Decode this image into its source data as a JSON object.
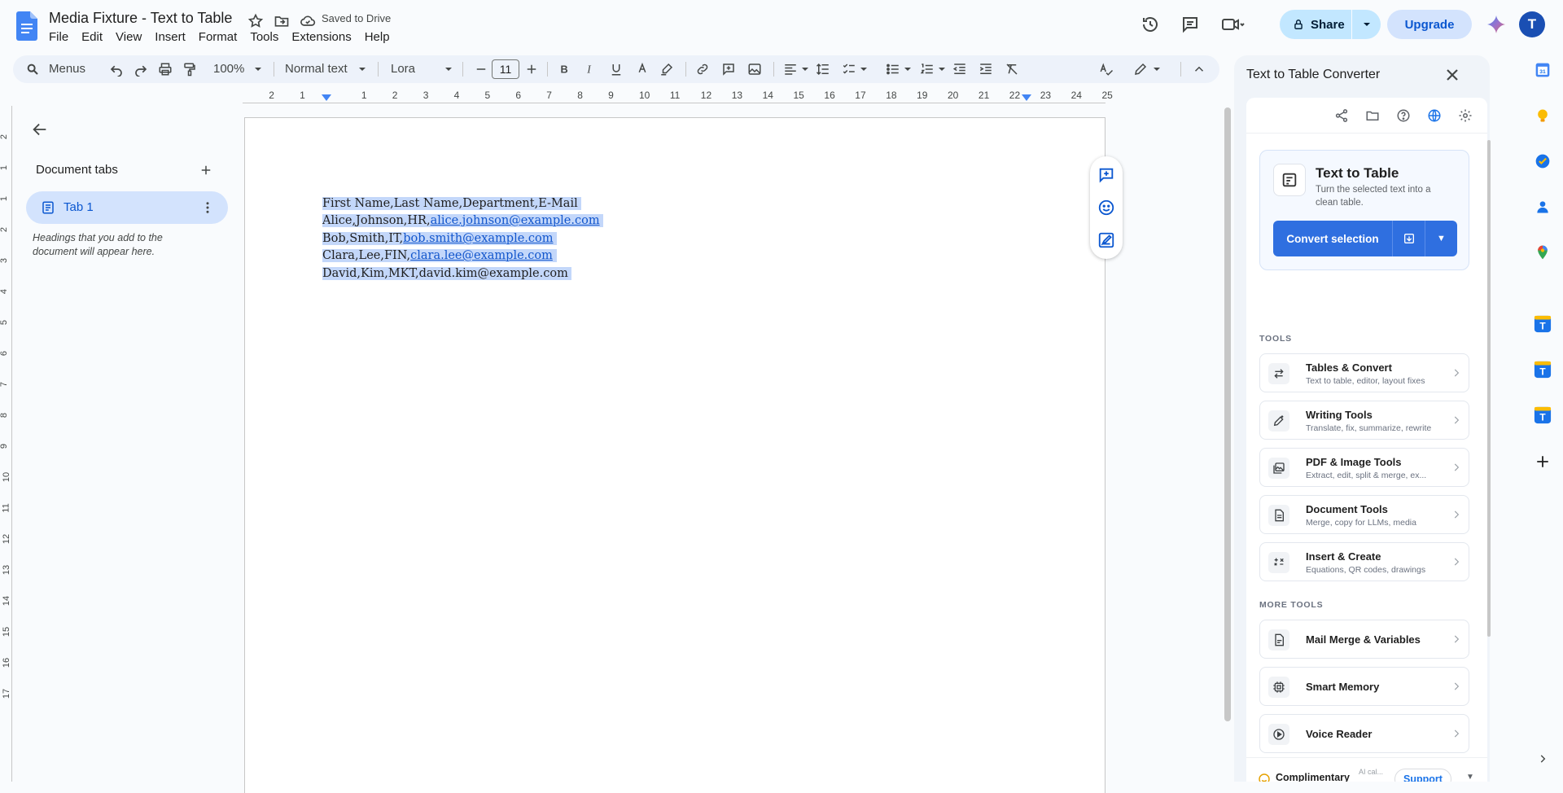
{
  "header": {
    "doc_title": "Media Fixture - Text to Table",
    "save_status": "Saved to Drive",
    "share_label": "Share",
    "upgrade_label": "Upgrade",
    "avatar_initial": "T",
    "menu": [
      "File",
      "Edit",
      "View",
      "Insert",
      "Format",
      "Tools",
      "Extensions",
      "Help"
    ]
  },
  "toolbar": {
    "menus_label": "Menus",
    "zoom": "100%",
    "style": "Normal text",
    "font": "Lora",
    "font_size": "11"
  },
  "ruler": {
    "left_ticks": [
      "2",
      "1"
    ],
    "ticks": [
      "1",
      "2",
      "3",
      "4",
      "5",
      "6",
      "7",
      "8",
      "9",
      "10",
      "11",
      "12",
      "13",
      "14",
      "15",
      "16",
      "17",
      "18",
      "19",
      "20",
      "21",
      "22",
      "23",
      "24",
      "25"
    ],
    "vertical_ticks": [
      "2",
      "1",
      "1",
      "2",
      "3",
      "4",
      "5",
      "6",
      "7",
      "8",
      "9",
      "10",
      "11",
      "12",
      "13",
      "14",
      "15",
      "16",
      "17"
    ]
  },
  "outline": {
    "heading": "Document tabs",
    "tab_label": "Tab 1",
    "hint": "Headings that you add to the document will appear here."
  },
  "document": {
    "lines": [
      {
        "text": "First Name,Last Name,Department,E-Mail",
        "prefix": "",
        "link": ""
      },
      {
        "text": "",
        "prefix": "Alice,Johnson,HR,",
        "link": "alice.johnson@example.com"
      },
      {
        "text": "",
        "prefix": "Bob,Smith,IT,",
        "link": "bob.smith@example.com"
      },
      {
        "text": "",
        "prefix": "Clara,Lee,FIN,",
        "link": "clara.lee@example.com"
      },
      {
        "text": "David,Kim,MKT,david.kim@example.com",
        "prefix": "",
        "link": ""
      }
    ]
  },
  "panel": {
    "title": "Text to Table Converter",
    "hero_title": "Text to Table",
    "hero_desc": "Turn the selected text into a clean table.",
    "convert_label": "Convert selection",
    "tools_heading": "TOOLS",
    "tools": [
      {
        "name": "Tables & Convert",
        "desc": "Text to table, editor, layout fixes",
        "icon": "swap-arrows-icon"
      },
      {
        "name": "Writing Tools",
        "desc": "Translate, fix, summarize, rewrite",
        "icon": "pen-sparkle-icon"
      },
      {
        "name": "PDF & Image Tools",
        "desc": "Extract, edit, split & merge, ex...",
        "icon": "images-icon"
      },
      {
        "name": "Document Tools",
        "desc": "Merge, copy for LLMs, media",
        "icon": "document-icon"
      },
      {
        "name": "Insert & Create",
        "desc": "Equations, QR codes, drawings",
        "icon": "formula-icon"
      }
    ],
    "more_heading": "MORE TOOLS",
    "more_tools": [
      {
        "name": "Mail Merge & Variables",
        "icon": "mail-merge-icon"
      },
      {
        "name": "Smart Memory",
        "icon": "memory-icon"
      },
      {
        "name": "Voice Reader",
        "icon": "play-circle-icon"
      }
    ],
    "footer": {
      "plan": "Complimentary",
      "ai_label": "AI cal...",
      "support": "Support"
    }
  },
  "colors": {
    "selection": "#c3d7fa",
    "link": "#1155cc",
    "primary_button": "#2f6fe0",
    "share_bg": "#c2e7ff",
    "upgrade_bg": "#d3e3fd"
  }
}
